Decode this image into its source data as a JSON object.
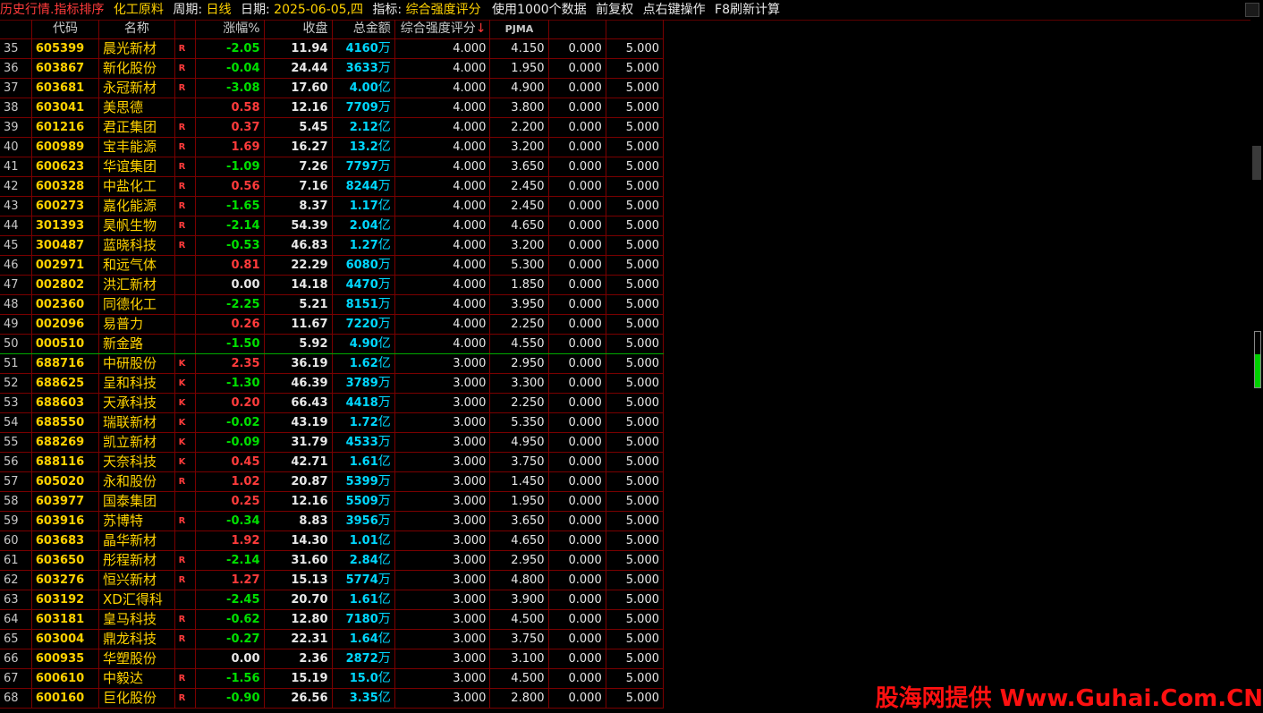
{
  "topbar": {
    "title": "历史行情.指标排序",
    "sector": "化工原料",
    "period_label": "周期:",
    "period": "日线",
    "date_label": "日期:",
    "date": "2025-06-05,四",
    "indicator_label": "指标:",
    "indicator": "综合强度评分",
    "usage": "使用1000个数据",
    "adjust": "前复权",
    "right_click": "点右键操作",
    "refresh": "F8刷新计算"
  },
  "columns": [
    "",
    "代码",
    "名称",
    "",
    "涨幅%",
    "收盘",
    "总金额",
    "综合强度评分",
    "PJMA",
    "",
    ""
  ],
  "sort_arrow": "↓",
  "rows": [
    {
      "idx": "35",
      "code": "605399",
      "name": "晨光新材",
      "flag": "R",
      "chg": "-2.05",
      "dir": "dn",
      "close": "11.94",
      "amt": "4160",
      "unit": "万",
      "score": "4.000",
      "pjma": "4.150",
      "c9": "0.000",
      "c10": "5.000"
    },
    {
      "idx": "36",
      "code": "603867",
      "name": "新化股份",
      "flag": "R",
      "chg": "-0.04",
      "dir": "dn",
      "close": "24.44",
      "amt": "3633",
      "unit": "万",
      "score": "4.000",
      "pjma": "1.950",
      "c9": "0.000",
      "c10": "5.000"
    },
    {
      "idx": "37",
      "code": "603681",
      "name": "永冠新材",
      "flag": "R",
      "chg": "-3.08",
      "dir": "dn",
      "close": "17.60",
      "amt": "4.00",
      "unit": "亿",
      "score": "4.000",
      "pjma": "4.900",
      "c9": "0.000",
      "c10": "5.000"
    },
    {
      "idx": "38",
      "code": "603041",
      "name": "美思德",
      "flag": "",
      "chg": "0.58",
      "dir": "up",
      "close": "12.16",
      "amt": "7709",
      "unit": "万",
      "score": "4.000",
      "pjma": "3.800",
      "c9": "0.000",
      "c10": "5.000"
    },
    {
      "idx": "39",
      "code": "601216",
      "name": "君正集团",
      "flag": "R",
      "chg": "0.37",
      "dir": "up",
      "close": "5.45",
      "amt": "2.12",
      "unit": "亿",
      "score": "4.000",
      "pjma": "2.200",
      "c9": "0.000",
      "c10": "5.000"
    },
    {
      "idx": "40",
      "code": "600989",
      "name": "宝丰能源",
      "flag": "R",
      "chg": "1.69",
      "dir": "up",
      "close": "16.27",
      "amt": "13.2",
      "unit": "亿",
      "score": "4.000",
      "pjma": "3.200",
      "c9": "0.000",
      "c10": "5.000"
    },
    {
      "idx": "41",
      "code": "600623",
      "name": "华谊集团",
      "flag": "R",
      "chg": "-1.09",
      "dir": "dn",
      "close": "7.26",
      "amt": "7797",
      "unit": "万",
      "score": "4.000",
      "pjma": "3.650",
      "c9": "0.000",
      "c10": "5.000"
    },
    {
      "idx": "42",
      "code": "600328",
      "name": "中盐化工",
      "flag": "R",
      "chg": "0.56",
      "dir": "up",
      "close": "7.16",
      "amt": "8244",
      "unit": "万",
      "score": "4.000",
      "pjma": "2.450",
      "c9": "0.000",
      "c10": "5.000"
    },
    {
      "idx": "43",
      "code": "600273",
      "name": "嘉化能源",
      "flag": "R",
      "chg": "-1.65",
      "dir": "dn",
      "close": "8.37",
      "amt": "1.17",
      "unit": "亿",
      "score": "4.000",
      "pjma": "2.450",
      "c9": "0.000",
      "c10": "5.000"
    },
    {
      "idx": "44",
      "code": "301393",
      "name": "昊帆生物",
      "flag": "R",
      "chg": "-2.14",
      "dir": "dn",
      "close": "54.39",
      "amt": "2.04",
      "unit": "亿",
      "score": "4.000",
      "pjma": "4.650",
      "c9": "0.000",
      "c10": "5.000"
    },
    {
      "idx": "45",
      "code": "300487",
      "name": "蓝晓科技",
      "flag": "R",
      "chg": "-0.53",
      "dir": "dn",
      "close": "46.83",
      "amt": "1.27",
      "unit": "亿",
      "score": "4.000",
      "pjma": "3.200",
      "c9": "0.000",
      "c10": "5.000"
    },
    {
      "idx": "46",
      "code": "002971",
      "name": "和远气体",
      "flag": "",
      "chg": "0.81",
      "dir": "up",
      "close": "22.29",
      "amt": "6080",
      "unit": "万",
      "score": "4.000",
      "pjma": "5.300",
      "c9": "0.000",
      "c10": "5.000"
    },
    {
      "idx": "47",
      "code": "002802",
      "name": "洪汇新材",
      "flag": "",
      "chg": "0.00",
      "dir": "flat",
      "close": "14.18",
      "amt": "4470",
      "unit": "万",
      "score": "4.000",
      "pjma": "1.850",
      "c9": "0.000",
      "c10": "5.000"
    },
    {
      "idx": "48",
      "code": "002360",
      "name": "同德化工",
      "flag": "",
      "chg": "-2.25",
      "dir": "dn",
      "close": "5.21",
      "amt": "8151",
      "unit": "万",
      "score": "4.000",
      "pjma": "3.950",
      "c9": "0.000",
      "c10": "5.000"
    },
    {
      "idx": "49",
      "code": "002096",
      "name": "易普力",
      "flag": "",
      "chg": "0.26",
      "dir": "up",
      "close": "11.67",
      "amt": "7220",
      "unit": "万",
      "score": "4.000",
      "pjma": "2.250",
      "c9": "0.000",
      "c10": "5.000"
    },
    {
      "idx": "50",
      "code": "000510",
      "name": "新金路",
      "flag": "",
      "chg": "-1.50",
      "dir": "dn",
      "close": "5.92",
      "amt": "4.90",
      "unit": "亿",
      "score": "4.000",
      "pjma": "4.550",
      "c9": "0.000",
      "c10": "5.000"
    },
    {
      "idx": "51",
      "code": "688716",
      "name": "中研股份",
      "flag": "K",
      "chg": "2.35",
      "dir": "up",
      "close": "36.19",
      "amt": "1.62",
      "unit": "亿",
      "score": "3.000",
      "pjma": "2.950",
      "c9": "0.000",
      "c10": "5.000"
    },
    {
      "idx": "52",
      "code": "688625",
      "name": "呈和科技",
      "flag": "K",
      "chg": "-1.30",
      "dir": "dn",
      "close": "46.39",
      "amt": "3789",
      "unit": "万",
      "score": "3.000",
      "pjma": "3.300",
      "c9": "0.000",
      "c10": "5.000"
    },
    {
      "idx": "53",
      "code": "688603",
      "name": "天承科技",
      "flag": "K",
      "chg": "0.20",
      "dir": "up",
      "close": "66.43",
      "amt": "4418",
      "unit": "万",
      "score": "3.000",
      "pjma": "2.250",
      "c9": "0.000",
      "c10": "5.000"
    },
    {
      "idx": "54",
      "code": "688550",
      "name": "瑞联新材",
      "flag": "K",
      "chg": "-0.02",
      "dir": "dn",
      "close": "43.19",
      "amt": "1.72",
      "unit": "亿",
      "score": "3.000",
      "pjma": "5.350",
      "c9": "0.000",
      "c10": "5.000"
    },
    {
      "idx": "55",
      "code": "688269",
      "name": "凯立新材",
      "flag": "K",
      "chg": "-0.09",
      "dir": "dn",
      "close": "31.79",
      "amt": "4533",
      "unit": "万",
      "score": "3.000",
      "pjma": "4.950",
      "c9": "0.000",
      "c10": "5.000"
    },
    {
      "idx": "56",
      "code": "688116",
      "name": "天奈科技",
      "flag": "K",
      "chg": "0.45",
      "dir": "up",
      "close": "42.71",
      "amt": "1.61",
      "unit": "亿",
      "score": "3.000",
      "pjma": "3.750",
      "c9": "0.000",
      "c10": "5.000"
    },
    {
      "idx": "57",
      "code": "605020",
      "name": "永和股份",
      "flag": "R",
      "chg": "1.02",
      "dir": "up",
      "close": "20.87",
      "amt": "5399",
      "unit": "万",
      "score": "3.000",
      "pjma": "1.450",
      "c9": "0.000",
      "c10": "5.000"
    },
    {
      "idx": "58",
      "code": "603977",
      "name": "国泰集团",
      "flag": "",
      "chg": "0.25",
      "dir": "up",
      "close": "12.16",
      "amt": "5509",
      "unit": "万",
      "score": "3.000",
      "pjma": "1.950",
      "c9": "0.000",
      "c10": "5.000"
    },
    {
      "idx": "59",
      "code": "603916",
      "name": "苏博特",
      "flag": "R",
      "chg": "-0.34",
      "dir": "dn",
      "close": "8.83",
      "amt": "3956",
      "unit": "万",
      "score": "3.000",
      "pjma": "3.650",
      "c9": "0.000",
      "c10": "5.000"
    },
    {
      "idx": "60",
      "code": "603683",
      "name": "晶华新材",
      "flag": "",
      "chg": "1.92",
      "dir": "up",
      "close": "14.30",
      "amt": "1.01",
      "unit": "亿",
      "score": "3.000",
      "pjma": "4.650",
      "c9": "0.000",
      "c10": "5.000"
    },
    {
      "idx": "61",
      "code": "603650",
      "name": "彤程新材",
      "flag": "R",
      "chg": "-2.14",
      "dir": "dn",
      "close": "31.60",
      "amt": "2.84",
      "unit": "亿",
      "score": "3.000",
      "pjma": "2.950",
      "c9": "0.000",
      "c10": "5.000"
    },
    {
      "idx": "62",
      "code": "603276",
      "name": "恒兴新材",
      "flag": "R",
      "chg": "1.27",
      "dir": "up",
      "close": "15.13",
      "amt": "5774",
      "unit": "万",
      "score": "3.000",
      "pjma": "4.800",
      "c9": "0.000",
      "c10": "5.000"
    },
    {
      "idx": "63",
      "code": "603192",
      "name": "XD汇得科",
      "flag": "",
      "chg": "-2.45",
      "dir": "dn",
      "close": "20.70",
      "amt": "1.61",
      "unit": "亿",
      "score": "3.000",
      "pjma": "3.900",
      "c9": "0.000",
      "c10": "5.000"
    },
    {
      "idx": "64",
      "code": "603181",
      "name": "皇马科技",
      "flag": "R",
      "chg": "-0.62",
      "dir": "dn",
      "close": "12.80",
      "amt": "7180",
      "unit": "万",
      "score": "3.000",
      "pjma": "4.500",
      "c9": "0.000",
      "c10": "5.000"
    },
    {
      "idx": "65",
      "code": "603004",
      "name": "鼎龙科技",
      "flag": "R",
      "chg": "-0.27",
      "dir": "dn",
      "close": "22.31",
      "amt": "1.64",
      "unit": "亿",
      "score": "3.000",
      "pjma": "3.750",
      "c9": "0.000",
      "c10": "5.000"
    },
    {
      "idx": "66",
      "code": "600935",
      "name": "华塑股份",
      "flag": "",
      "chg": "0.00",
      "dir": "flat",
      "close": "2.36",
      "amt": "2872",
      "unit": "万",
      "score": "3.000",
      "pjma": "3.100",
      "c9": "0.000",
      "c10": "5.000"
    },
    {
      "idx": "67",
      "code": "600610",
      "name": "中毅达",
      "flag": "R",
      "chg": "-1.56",
      "dir": "dn",
      "close": "15.19",
      "amt": "15.0",
      "unit": "亿",
      "score": "3.000",
      "pjma": "4.500",
      "c9": "0.000",
      "c10": "5.000"
    },
    {
      "idx": "68",
      "code": "600160",
      "name": "巨化股份",
      "flag": "R",
      "chg": "-0.90",
      "dir": "dn",
      "close": "26.56",
      "amt": "3.35",
      "unit": "亿",
      "score": "3.000",
      "pjma": "2.800",
      "c9": "0.000",
      "c10": "5.000"
    }
  ],
  "watermark": "股海网提供 Www.Guhai.Com.CN",
  "colors": {
    "up": "#ff3b3b",
    "down": "#00e000",
    "amount": "#00d8ff",
    "name": "#ffd200"
  }
}
